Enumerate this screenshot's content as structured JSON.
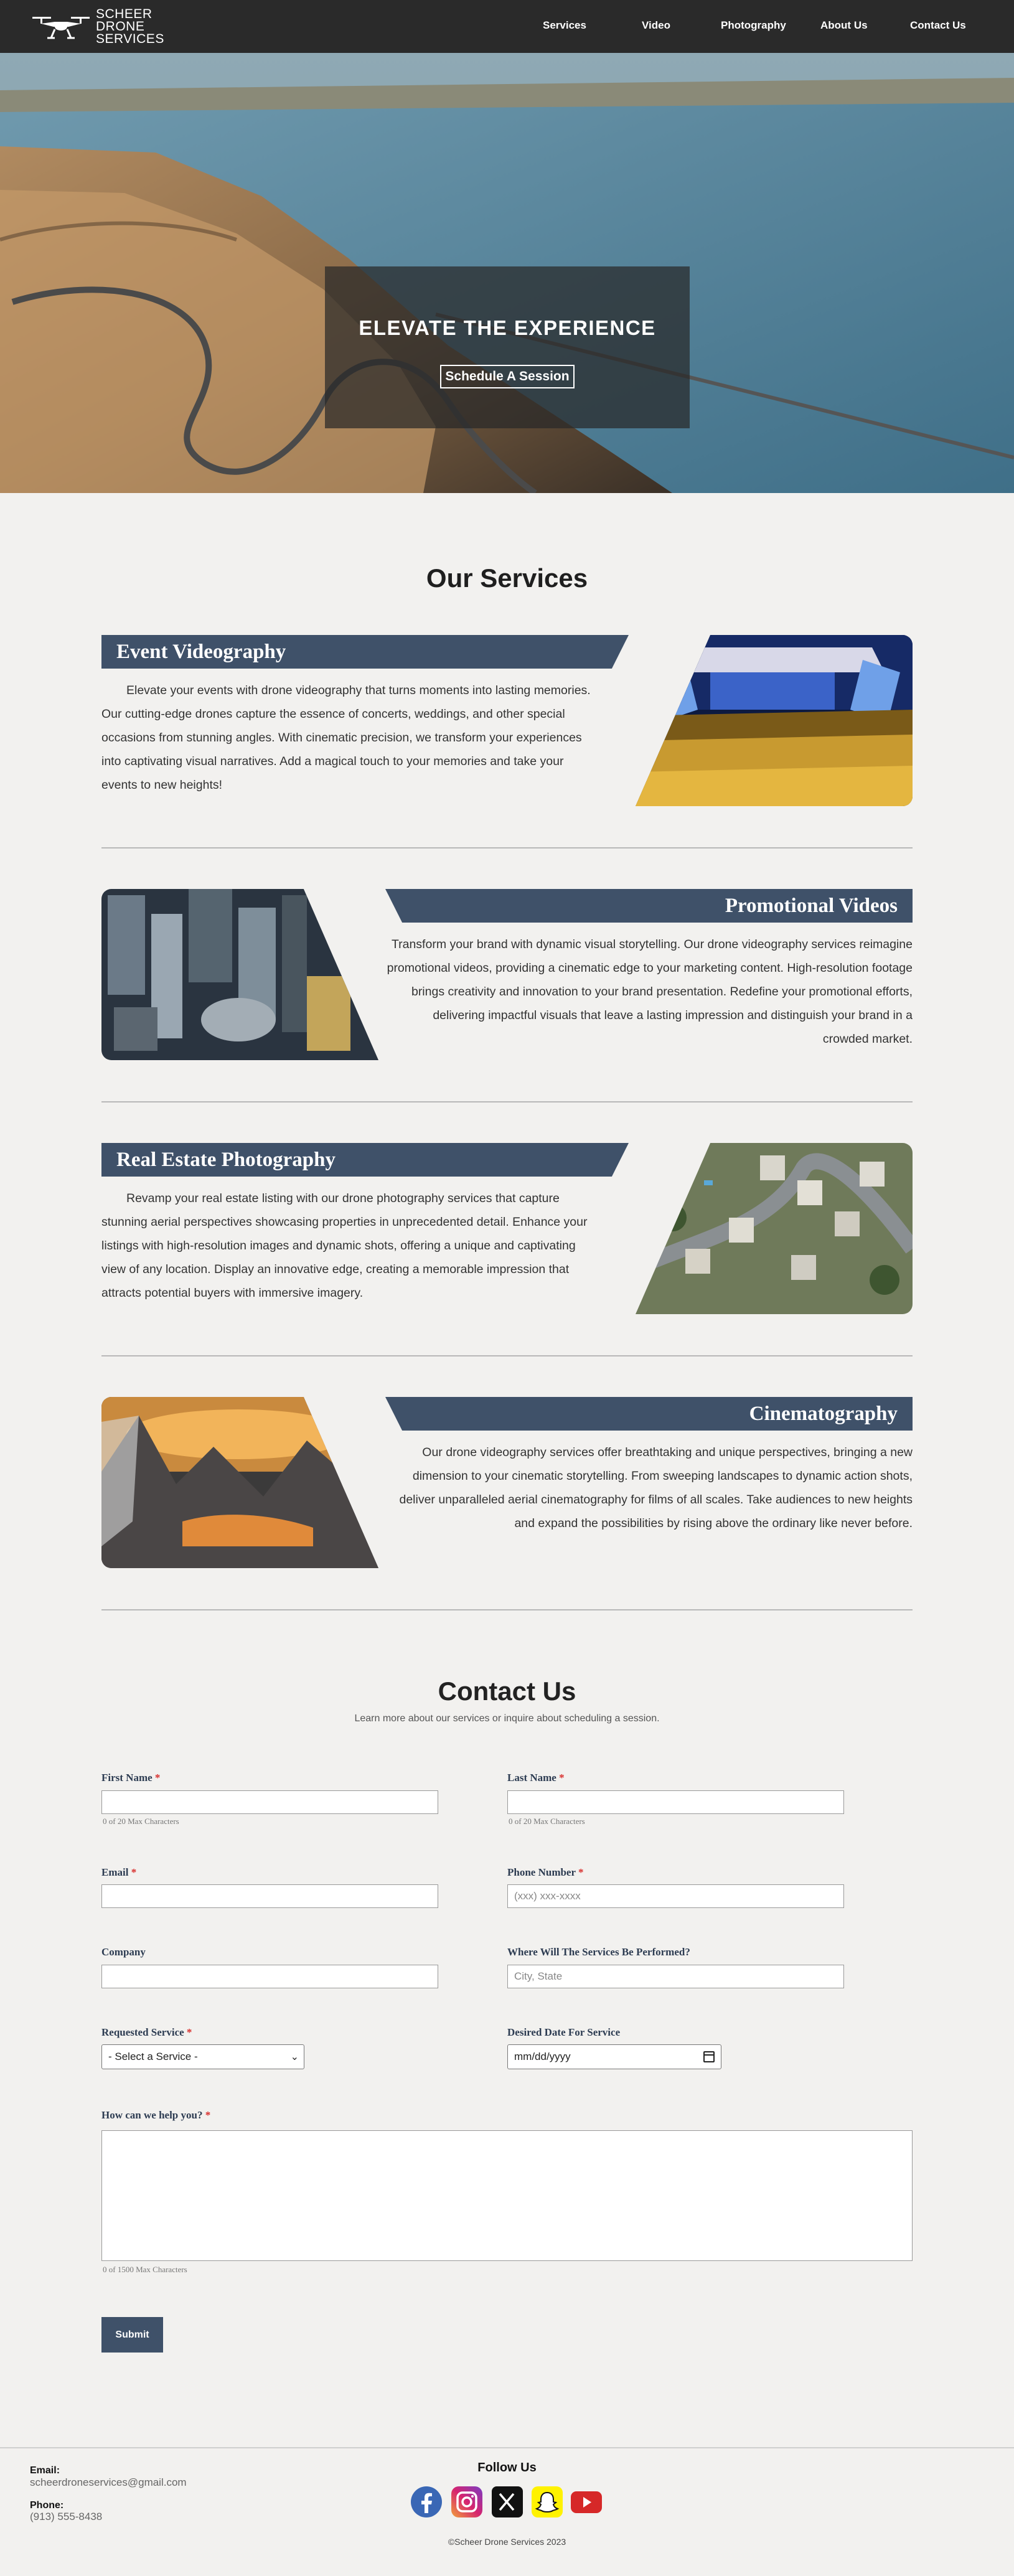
{
  "nav": {
    "logo_text_lines": [
      "SCHEER",
      "DRONE",
      "SERVICES"
    ],
    "links": [
      "Services",
      "Video",
      "Photography",
      "About Us",
      "Contact Us"
    ]
  },
  "hero": {
    "title": "ELEVATE THE EXPERIENCE",
    "button": "Schedule A Session"
  },
  "services": {
    "title": "Our Services",
    "items": [
      {
        "title": "Event Videography",
        "text": "Elevate your events with drone videography that turns moments into lasting memories. Our cutting-edge drones capture the essence of concerts, weddings, and other special occasions from stunning angles. With cinematic precision, we transform your experiences into captivating visual narratives. Add a magical touch to your memories and take your events to new heights!"
      },
      {
        "title": "Promotional Videos",
        "text": "Transform your brand with dynamic visual storytelling. Our drone videography services reimagine promotional videos, providing a cinematic edge to your marketing content. High-resolution footage brings creativity and innovation to your brand presentation. Redefine your promotional efforts, delivering impactful visuals that leave a lasting impression and distinguish your brand in a crowded market."
      },
      {
        "title": "Real Estate Photography",
        "text": "Revamp your real estate listing with our drone photography services that capture stunning aerial perspectives showcasing properties in unprecedented detail. Enhance your listings with high-resolution images and dynamic shots, offering a unique and captivating view of any location. Display an innovative edge, creating a memorable impression that attracts potential buyers with immersive imagery."
      },
      {
        "title": "Cinematography",
        "text": "Our drone videography services offer breathtaking and unique perspectives, bringing a new dimension to your cinematic storytelling. From sweeping landscapes to dynamic action shots, deliver unparalleled aerial cinematography for films of all scales. Take audiences to new heights and expand the possibilities by rising above the ordinary like never before."
      }
    ]
  },
  "contact": {
    "title": "Contact Us",
    "subtitle": "Learn more about our services or inquire about scheduling a session.",
    "required_mark": "*",
    "first_name_label": "First Name",
    "first_name_count": "0 of 20 Max Characters",
    "last_name_label": "Last Name",
    "last_name_count": "0 of 20 Max Characters",
    "email_label": "Email",
    "phone_label": "Phone Number",
    "phone_placeholder": "(xxx) xxx-xxxx",
    "company_label": "Company",
    "location_label": "Where Will The Services Be Performed?",
    "location_placeholder": "City, State",
    "service_label": "Requested Service",
    "service_selected": "- Select a Service -",
    "date_label": "Desired Date For Service",
    "date_placeholder": "mm/dd/yyyy",
    "message_label": "How can we help you?",
    "message_count": "0 of 1500 Max Characters",
    "submit": "Submit"
  },
  "footer": {
    "email_label": "Email:",
    "email": "scheerdroneservices@gmail.com",
    "phone_label": "Phone:",
    "phone": "(913) 555-8438",
    "follow": "Follow Us",
    "social": [
      "facebook-icon",
      "instagram-icon",
      "x-icon",
      "snapchat-icon",
      "youtube-icon"
    ],
    "copyright": "©Scheer Drone Services 2023"
  },
  "colors": {
    "nav_bg": "#2a2a2a",
    "accent": "#3f5169",
    "page_bg": "#f2f1ef",
    "required": "#d8302e"
  }
}
